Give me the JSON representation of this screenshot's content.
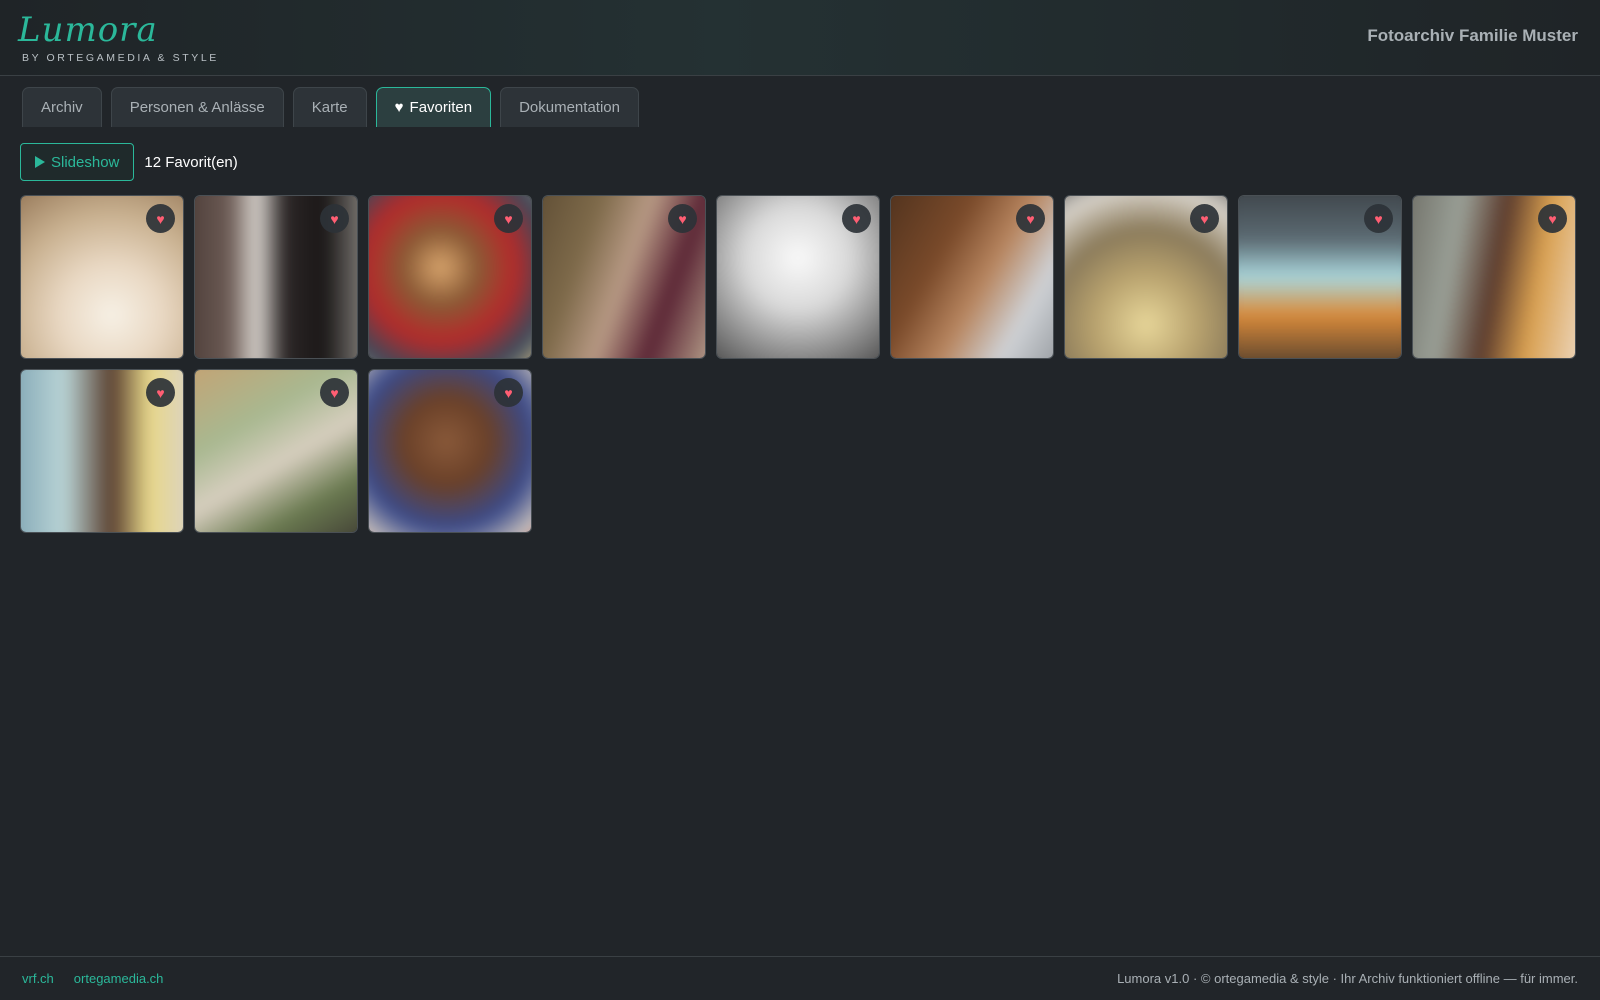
{
  "header": {
    "logo_text": "Lumora",
    "logo_subtitle": "BY ORTEGAMEDIA & STYLE",
    "title": "Fotoarchiv Familie Muster"
  },
  "tabs": [
    {
      "label": "Archiv",
      "active": false
    },
    {
      "label": "Personen & Anlässe",
      "active": false
    },
    {
      "label": "Karte",
      "active": false
    },
    {
      "label": "Favoriten",
      "active": true,
      "icon": "heart-icon"
    },
    {
      "label": "Dokumentation",
      "active": false
    }
  ],
  "toolbar": {
    "slideshow_label": "Slideshow",
    "count_label": "12 Favorit(en)"
  },
  "gallery": {
    "favorite_icon": "♥",
    "items": [
      {
        "id": 1,
        "favorite": true
      },
      {
        "id": 2,
        "favorite": true
      },
      {
        "id": 3,
        "favorite": true
      },
      {
        "id": 4,
        "favorite": true
      },
      {
        "id": 5,
        "favorite": true
      },
      {
        "id": 6,
        "favorite": true
      },
      {
        "id": 7,
        "favorite": true
      },
      {
        "id": 8,
        "favorite": true
      },
      {
        "id": 9,
        "favorite": true
      },
      {
        "id": 10,
        "favorite": true
      },
      {
        "id": 11,
        "favorite": true
      },
      {
        "id": 12,
        "favorite": true
      }
    ]
  },
  "footer": {
    "links": [
      "vrf.ch",
      "ortegamedia.ch"
    ],
    "copyright": "Lumora v1.0 · © ortegamedia & style · Ihr Archiv funktioniert offline — für immer."
  },
  "colors": {
    "accent": "#2bb89a",
    "background": "#212529",
    "favorite": "#ff5e73"
  }
}
